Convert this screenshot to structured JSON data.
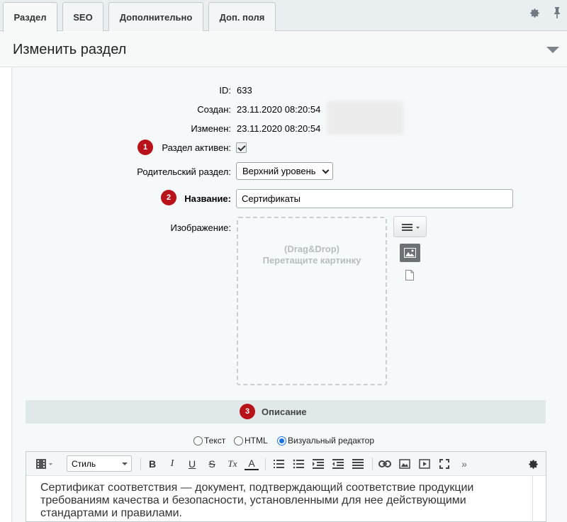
{
  "tabs": [
    {
      "label": "Раздел",
      "active": true
    },
    {
      "label": "SEO",
      "active": false
    },
    {
      "label": "Дополнительно",
      "active": false
    },
    {
      "label": "Доп. поля",
      "active": false
    }
  ],
  "section": {
    "title": "Изменить раздел"
  },
  "fields": {
    "id_label": "ID:",
    "id_value": "633",
    "created_label": "Создан:",
    "created_value": "23.11.2020 08:20:54",
    "modified_label": "Изменен:",
    "modified_value": "23.11.2020 08:20:54",
    "active_label": "Раздел активен:",
    "active_checked": true,
    "parent_label": "Родительский раздел:",
    "parent_value": "Верхний уровень",
    "name_label": "Название:",
    "name_value": "Сертификаты",
    "image_label": "Изображение:",
    "dropzone_line1": "(Drag&Drop)",
    "dropzone_line2": "Перетащите картинку"
  },
  "badges": [
    "1",
    "2",
    "3"
  ],
  "description": {
    "title": "Описание",
    "modes": [
      {
        "label": "Текст",
        "selected": false
      },
      {
        "label": "HTML",
        "selected": false
      },
      {
        "label": "Визуальный редактор",
        "selected": true
      }
    ],
    "style_select": "Стиль",
    "text": "Сертификат соответствия — документ, подтверждающий соответствие продукции требованиям качества и безопасности, установленными для нее действующими стандартами и правилами."
  },
  "toolbar_buttons": [
    "B",
    "I",
    "U",
    "S",
    "Tx",
    "A"
  ],
  "colors": {
    "badge": "#b8131a",
    "radio_accent": "#1a73e8"
  }
}
